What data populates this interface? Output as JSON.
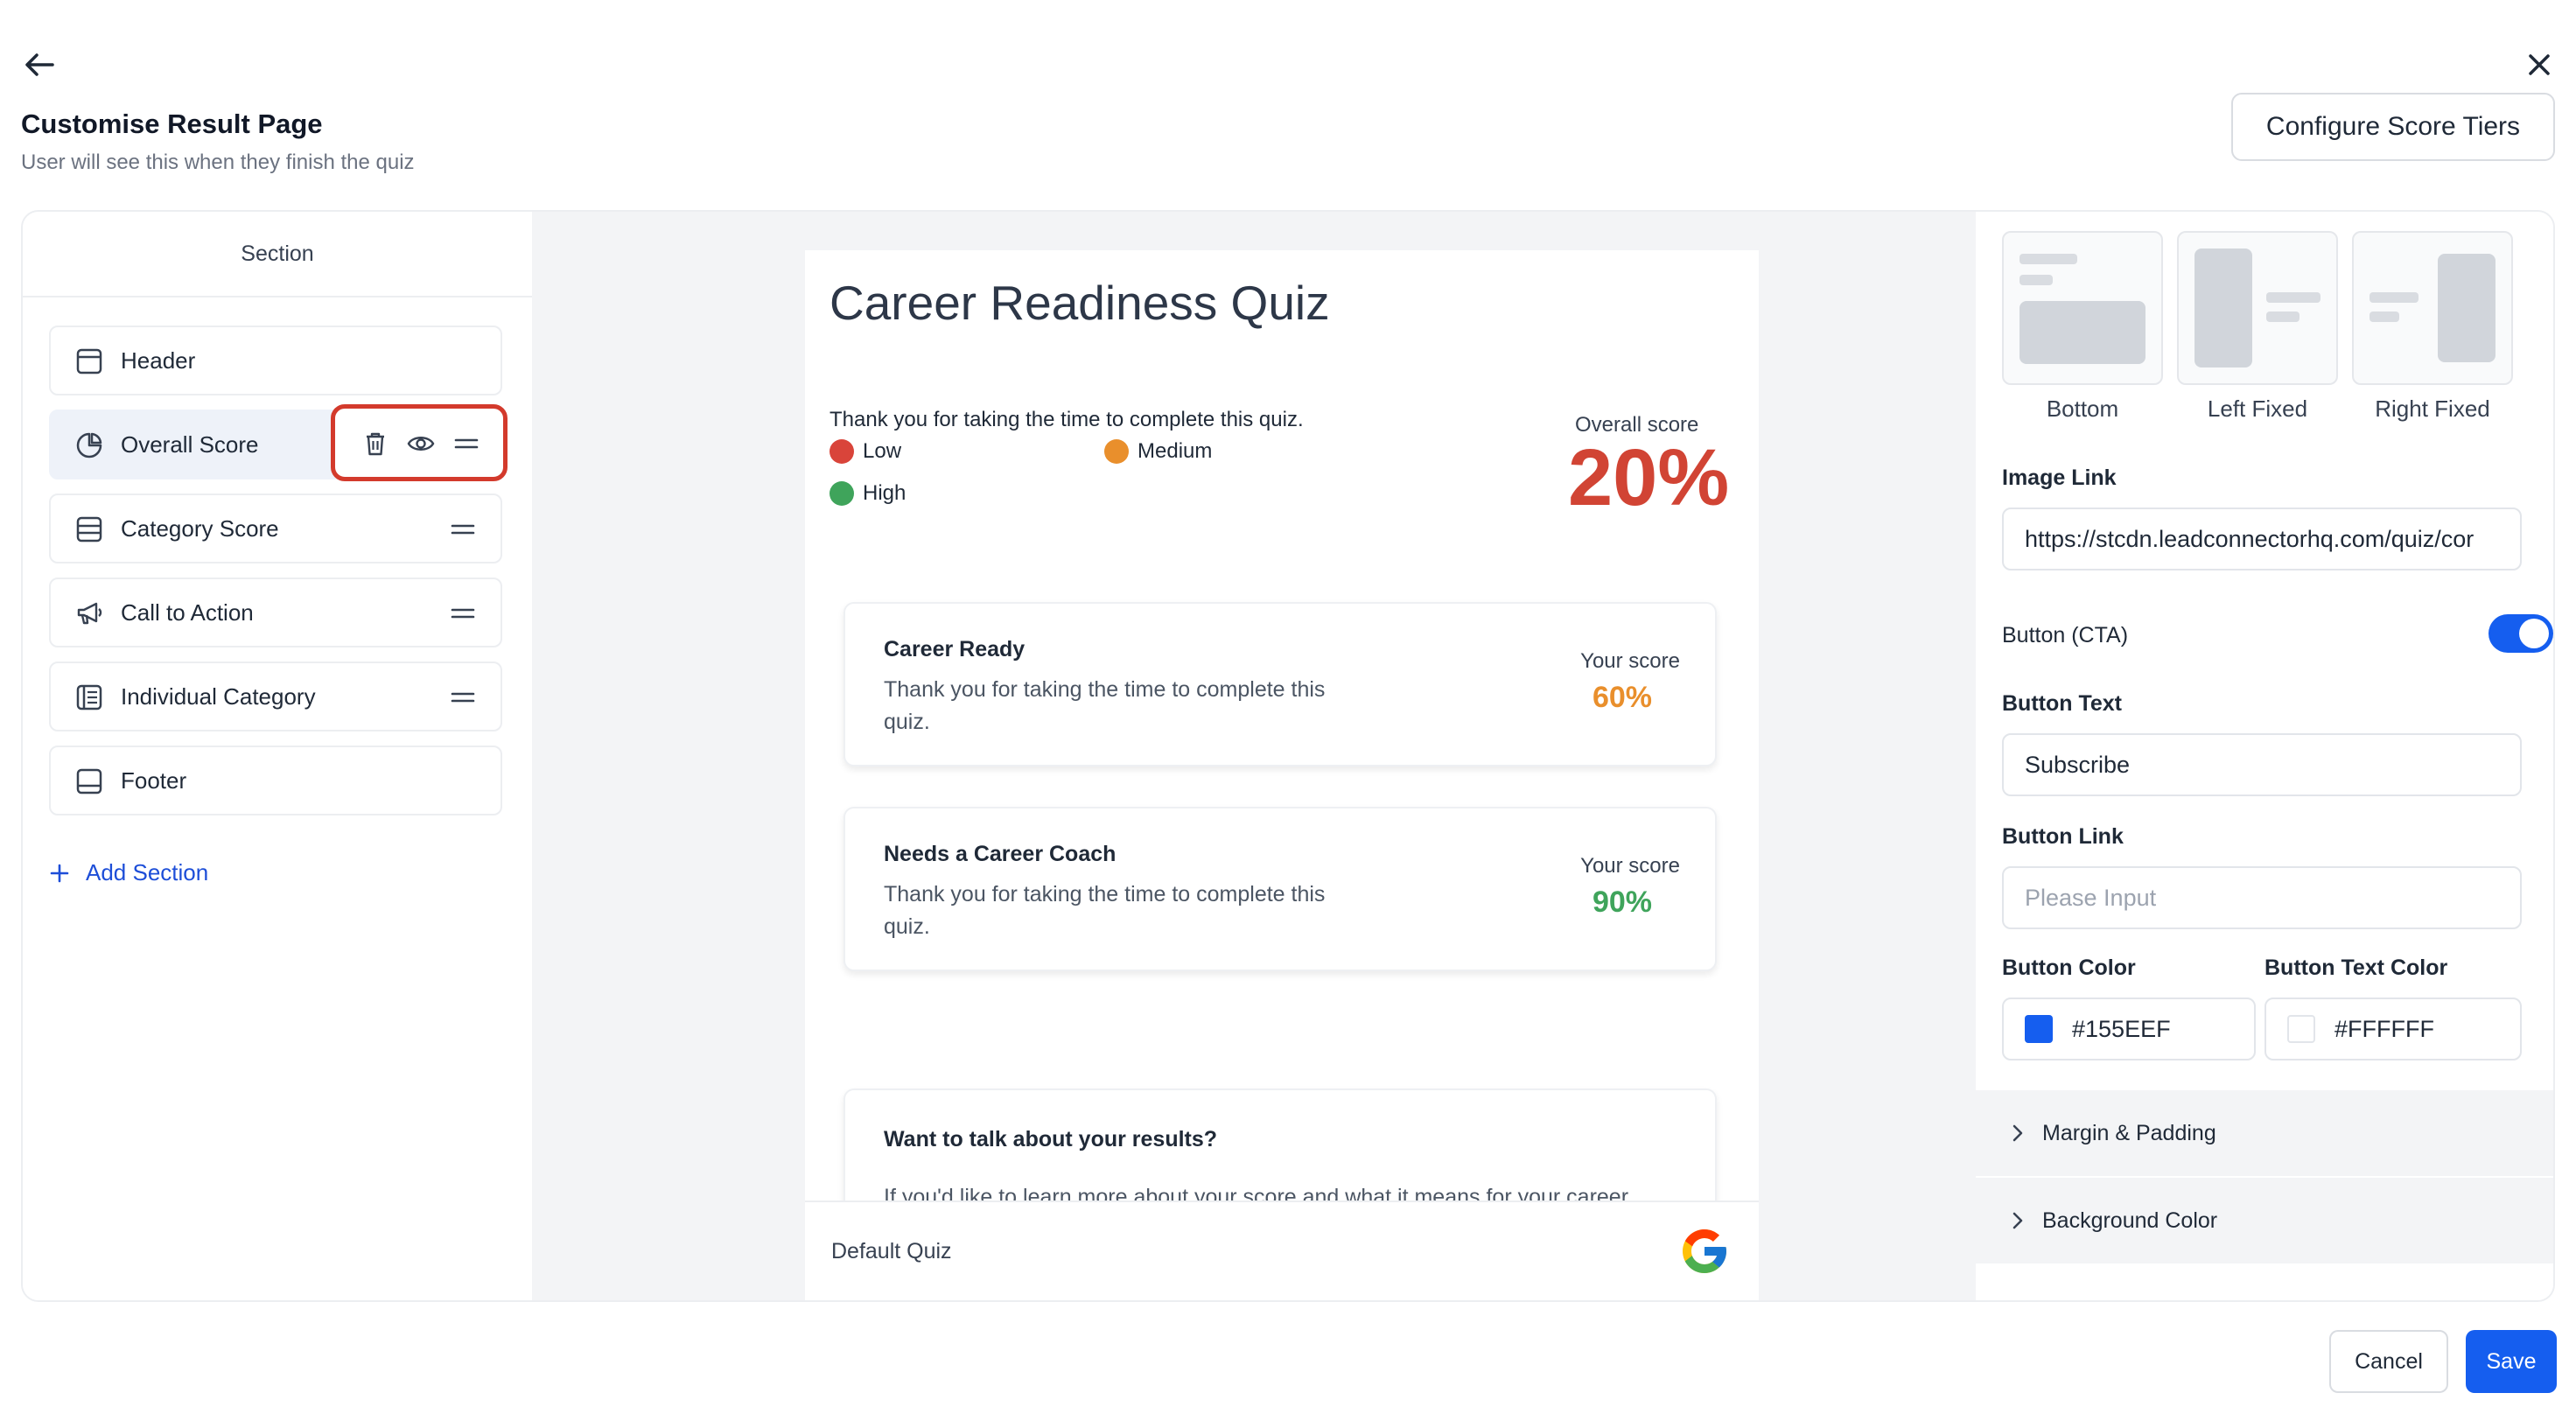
{
  "header": {
    "title": "Customise Result Page",
    "subtitle": "User will see this when they finish the quiz",
    "configure_button": "Configure Score Tiers"
  },
  "sidebar": {
    "heading": "Section",
    "items": [
      {
        "label": "Header",
        "icon": "header-layout-icon"
      },
      {
        "label": "Overall Score",
        "icon": "pie-chart-icon",
        "active": true
      },
      {
        "label": "Category Score",
        "icon": "list-layout-icon"
      },
      {
        "label": "Call to Action",
        "icon": "megaphone-icon"
      },
      {
        "label": "Individual Category",
        "icon": "category-layout-icon"
      },
      {
        "label": "Footer",
        "icon": "footer-layout-icon"
      }
    ],
    "add_section": "Add Section"
  },
  "preview": {
    "quiz_title": "Career Readiness Quiz",
    "thanks_text": "Thank you for taking the time to complete this quiz.",
    "legend": [
      {
        "label": "Low",
        "color": "#d9443a"
      },
      {
        "label": "Medium",
        "color": "#e98f2c"
      },
      {
        "label": "High",
        "color": "#3fa45b"
      }
    ],
    "overall_label": "Overall score",
    "overall_value": "20%",
    "overall_color": "#d14434",
    "categories": [
      {
        "name": "Career Ready",
        "description": "Thank you for taking the time to complete this quiz.",
        "score_label": "Your score",
        "score": "60%",
        "color": "#e98f2c"
      },
      {
        "name": "Needs a Career Coach",
        "description": "Thank you for taking the time to complete this quiz.",
        "score_label": "Your score",
        "score": "90%",
        "color": "#3fa45b"
      }
    ],
    "cta": {
      "title": "Want to talk about your results?",
      "text": "If you'd like to learn more about your score and what it means for your career"
    },
    "footer_text": "Default Quiz"
  },
  "settings": {
    "layouts": [
      "Bottom",
      "Left Fixed",
      "Right Fixed"
    ],
    "image_link_label": "Image Link",
    "image_link_value": "https://stcdn.leadconnectorhq.com/quiz/cor",
    "button_cta_label": "Button (CTA)",
    "button_cta_enabled": true,
    "button_text_label": "Button Text",
    "button_text_value": "Subscribe",
    "button_link_label": "Button Link",
    "button_link_placeholder": "Please Input",
    "button_color_label": "Button Color",
    "button_color_value": "#155EEF",
    "button_text_color_label": "Button Text Color",
    "button_text_color_value": "#FFFFFF",
    "margin_padding": "Margin & Padding",
    "background_color": "Background Color"
  },
  "footer_actions": {
    "cancel": "Cancel",
    "save": "Save"
  }
}
